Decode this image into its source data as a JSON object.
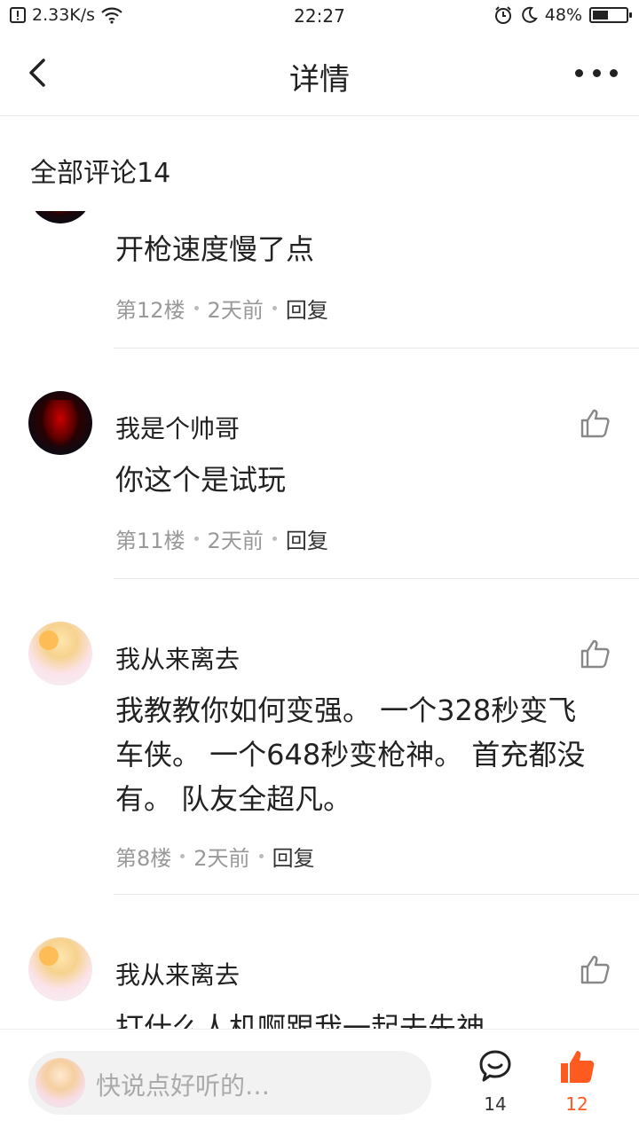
{
  "status": {
    "net_speed": "2.33K/s",
    "time": "22:27",
    "battery": "48%",
    "battery_level": 0.48
  },
  "nav": {
    "title": "详情"
  },
  "section": {
    "title": "全部评论14"
  },
  "comments": [
    {
      "content": "开枪速度慢了点",
      "floor": "第12楼",
      "time": "2天前",
      "reply": "回复"
    },
    {
      "username": "我是个帅哥",
      "content": "你这个是试玩",
      "floor": "第11楼",
      "time": "2天前",
      "reply": "回复"
    },
    {
      "username": "我从来离去",
      "content": "我教教你如何变强。 一个328秒变飞车侠。 一个648秒变枪神。 首充都没 有。 队友全超凡。",
      "floor": "第8楼",
      "time": "2天前",
      "reply": "回复"
    },
    {
      "username": "我从来离去",
      "content": "打什么人机啊跟我一起去先神"
    }
  ],
  "bottom": {
    "input_placeholder": "快说点好听的…",
    "comment_count": "14",
    "like_count": "12",
    "accent_color": "#ff5a1f"
  }
}
